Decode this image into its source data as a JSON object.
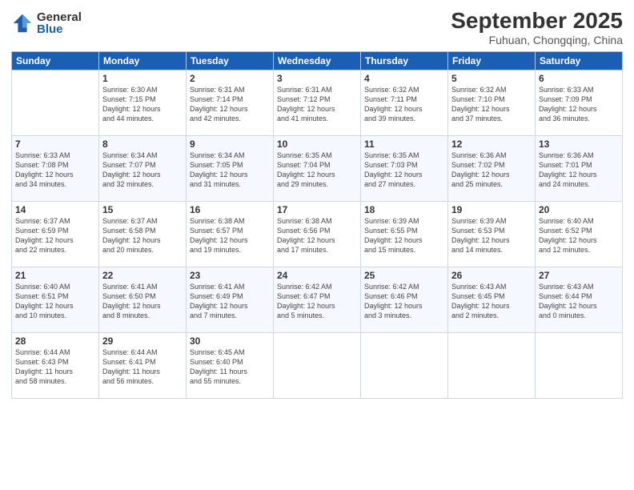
{
  "logo": {
    "general": "General",
    "blue": "Blue"
  },
  "title": "September 2025",
  "location": "Fuhuan, Chongqing, China",
  "days_of_week": [
    "Sunday",
    "Monday",
    "Tuesday",
    "Wednesday",
    "Thursday",
    "Friday",
    "Saturday"
  ],
  "weeks": [
    [
      {
        "day": "",
        "info": ""
      },
      {
        "day": "1",
        "info": "Sunrise: 6:30 AM\nSunset: 7:15 PM\nDaylight: 12 hours\nand 44 minutes."
      },
      {
        "day": "2",
        "info": "Sunrise: 6:31 AM\nSunset: 7:14 PM\nDaylight: 12 hours\nand 42 minutes."
      },
      {
        "day": "3",
        "info": "Sunrise: 6:31 AM\nSunset: 7:12 PM\nDaylight: 12 hours\nand 41 minutes."
      },
      {
        "day": "4",
        "info": "Sunrise: 6:32 AM\nSunset: 7:11 PM\nDaylight: 12 hours\nand 39 minutes."
      },
      {
        "day": "5",
        "info": "Sunrise: 6:32 AM\nSunset: 7:10 PM\nDaylight: 12 hours\nand 37 minutes."
      },
      {
        "day": "6",
        "info": "Sunrise: 6:33 AM\nSunset: 7:09 PM\nDaylight: 12 hours\nand 36 minutes."
      }
    ],
    [
      {
        "day": "7",
        "info": "Sunrise: 6:33 AM\nSunset: 7:08 PM\nDaylight: 12 hours\nand 34 minutes."
      },
      {
        "day": "8",
        "info": "Sunrise: 6:34 AM\nSunset: 7:07 PM\nDaylight: 12 hours\nand 32 minutes."
      },
      {
        "day": "9",
        "info": "Sunrise: 6:34 AM\nSunset: 7:05 PM\nDaylight: 12 hours\nand 31 minutes."
      },
      {
        "day": "10",
        "info": "Sunrise: 6:35 AM\nSunset: 7:04 PM\nDaylight: 12 hours\nand 29 minutes."
      },
      {
        "day": "11",
        "info": "Sunrise: 6:35 AM\nSunset: 7:03 PM\nDaylight: 12 hours\nand 27 minutes."
      },
      {
        "day": "12",
        "info": "Sunrise: 6:36 AM\nSunset: 7:02 PM\nDaylight: 12 hours\nand 25 minutes."
      },
      {
        "day": "13",
        "info": "Sunrise: 6:36 AM\nSunset: 7:01 PM\nDaylight: 12 hours\nand 24 minutes."
      }
    ],
    [
      {
        "day": "14",
        "info": "Sunrise: 6:37 AM\nSunset: 6:59 PM\nDaylight: 12 hours\nand 22 minutes."
      },
      {
        "day": "15",
        "info": "Sunrise: 6:37 AM\nSunset: 6:58 PM\nDaylight: 12 hours\nand 20 minutes."
      },
      {
        "day": "16",
        "info": "Sunrise: 6:38 AM\nSunset: 6:57 PM\nDaylight: 12 hours\nand 19 minutes."
      },
      {
        "day": "17",
        "info": "Sunrise: 6:38 AM\nSunset: 6:56 PM\nDaylight: 12 hours\nand 17 minutes."
      },
      {
        "day": "18",
        "info": "Sunrise: 6:39 AM\nSunset: 6:55 PM\nDaylight: 12 hours\nand 15 minutes."
      },
      {
        "day": "19",
        "info": "Sunrise: 6:39 AM\nSunset: 6:53 PM\nDaylight: 12 hours\nand 14 minutes."
      },
      {
        "day": "20",
        "info": "Sunrise: 6:40 AM\nSunset: 6:52 PM\nDaylight: 12 hours\nand 12 minutes."
      }
    ],
    [
      {
        "day": "21",
        "info": "Sunrise: 6:40 AM\nSunset: 6:51 PM\nDaylight: 12 hours\nand 10 minutes."
      },
      {
        "day": "22",
        "info": "Sunrise: 6:41 AM\nSunset: 6:50 PM\nDaylight: 12 hours\nand 8 minutes."
      },
      {
        "day": "23",
        "info": "Sunrise: 6:41 AM\nSunset: 6:49 PM\nDaylight: 12 hours\nand 7 minutes."
      },
      {
        "day": "24",
        "info": "Sunrise: 6:42 AM\nSunset: 6:47 PM\nDaylight: 12 hours\nand 5 minutes."
      },
      {
        "day": "25",
        "info": "Sunrise: 6:42 AM\nSunset: 6:46 PM\nDaylight: 12 hours\nand 3 minutes."
      },
      {
        "day": "26",
        "info": "Sunrise: 6:43 AM\nSunset: 6:45 PM\nDaylight: 12 hours\nand 2 minutes."
      },
      {
        "day": "27",
        "info": "Sunrise: 6:43 AM\nSunset: 6:44 PM\nDaylight: 12 hours\nand 0 minutes."
      }
    ],
    [
      {
        "day": "28",
        "info": "Sunrise: 6:44 AM\nSunset: 6:43 PM\nDaylight: 11 hours\nand 58 minutes."
      },
      {
        "day": "29",
        "info": "Sunrise: 6:44 AM\nSunset: 6:41 PM\nDaylight: 11 hours\nand 56 minutes."
      },
      {
        "day": "30",
        "info": "Sunrise: 6:45 AM\nSunset: 6:40 PM\nDaylight: 11 hours\nand 55 minutes."
      },
      {
        "day": "",
        "info": ""
      },
      {
        "day": "",
        "info": ""
      },
      {
        "day": "",
        "info": ""
      },
      {
        "day": "",
        "info": ""
      }
    ]
  ]
}
